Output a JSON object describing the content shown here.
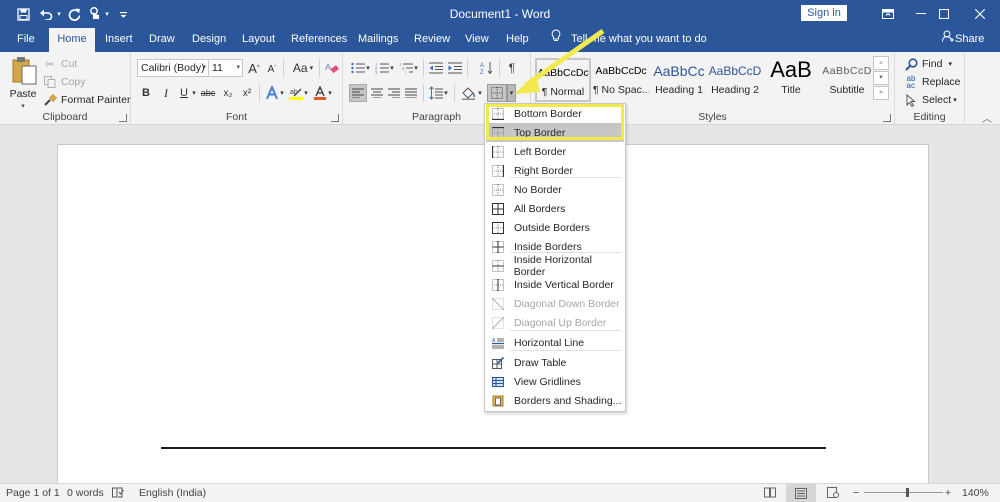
{
  "titlebar": {
    "document_title": "Document1  -  Word",
    "sign_in_label": "Sign in",
    "qat": {
      "save_icon": "save-icon",
      "undo_icon": "undo-icon",
      "redo_icon": "redo-icon",
      "touch_icon": "touch-mode-icon",
      "customize_icon": "customize-qat-icon"
    },
    "window_buttons": {
      "ribbon_display": "ribbon-display-options",
      "minimize": "minimize",
      "maximize": "maximize",
      "close": "close"
    }
  },
  "tabs": [
    {
      "label": "File"
    },
    {
      "label": "Home",
      "active": true
    },
    {
      "label": "Insert"
    },
    {
      "label": "Draw"
    },
    {
      "label": "Design"
    },
    {
      "label": "Layout"
    },
    {
      "label": "References"
    },
    {
      "label": "Mailings"
    },
    {
      "label": "Review"
    },
    {
      "label": "View"
    },
    {
      "label": "Help"
    }
  ],
  "tell_me": "Tell me what you want to do",
  "share_label": "Share",
  "ribbon": {
    "clipboard": {
      "label": "Clipboard",
      "paste": "Paste",
      "cut": "Cut",
      "copy": "Copy",
      "format_painter": "Format Painter"
    },
    "font": {
      "label": "Font",
      "font_name": "Calibri (Body)",
      "font_size": "11",
      "grow": "A",
      "shrink": "A",
      "change_case": "Aa",
      "bold": "B",
      "italic": "I",
      "underline": "U",
      "strikethrough": "abc",
      "subscript": "x₂",
      "superscript": "x²",
      "highlight_color": "#ffff00",
      "font_color": "#e0592a"
    },
    "paragraph": {
      "label": "Paragraph"
    },
    "styles": {
      "label": "Styles",
      "items": [
        {
          "preview": "AaBbCcDc",
          "name": "¶ Normal",
          "selected": true
        },
        {
          "preview": "AaBbCcDc",
          "name": "¶ No Spac..."
        },
        {
          "preview": "AaBbCc",
          "name": "Heading 1"
        },
        {
          "preview": "AaBbCcD",
          "name": "Heading 2"
        },
        {
          "preview": "AaB",
          "name": "Title"
        },
        {
          "preview": "AaBbCcD",
          "name": "Subtitle"
        }
      ]
    },
    "editing": {
      "label": "Editing",
      "find": "Find",
      "replace": "Replace",
      "select": "Select"
    }
  },
  "borders_menu": {
    "items": [
      {
        "label": "Bottom Border",
        "icon": "bottom-border-icon"
      },
      {
        "label": "Top Border",
        "icon": "top-border-icon",
        "highlighted": true
      },
      {
        "label": "Left Border",
        "icon": "left-border-icon"
      },
      {
        "label": "Right Border",
        "icon": "right-border-icon"
      },
      {
        "label": "No Border",
        "icon": "no-border-icon"
      },
      {
        "label": "All Borders",
        "icon": "all-borders-icon"
      },
      {
        "label": "Outside Borders",
        "icon": "outside-borders-icon"
      },
      {
        "label": "Inside Borders",
        "icon": "inside-borders-icon"
      },
      {
        "label": "Inside Horizontal Border",
        "icon": "inside-horizontal-border-icon"
      },
      {
        "label": "Inside Vertical Border",
        "icon": "inside-vertical-border-icon"
      },
      {
        "label": "Diagonal Down Border",
        "icon": "diagonal-down-border-icon",
        "disabled": true
      },
      {
        "label": "Diagonal Up Border",
        "icon": "diagonal-up-border-icon",
        "disabled": true
      },
      {
        "label": "Horizontal Line",
        "icon": "horizontal-line-icon"
      },
      {
        "label": "Draw Table",
        "icon": "draw-table-icon"
      },
      {
        "label": "View Gridlines",
        "icon": "view-gridlines-icon"
      },
      {
        "label": "Borders and Shading...",
        "icon": "borders-shading-icon"
      }
    ],
    "highlight_color": "#f2e94e"
  },
  "statusbar": {
    "page": "Page 1 of 1",
    "words": "0 words",
    "language": "English (India)",
    "zoom_minus": "−",
    "zoom_plus": "+",
    "zoom_level": "140%"
  }
}
